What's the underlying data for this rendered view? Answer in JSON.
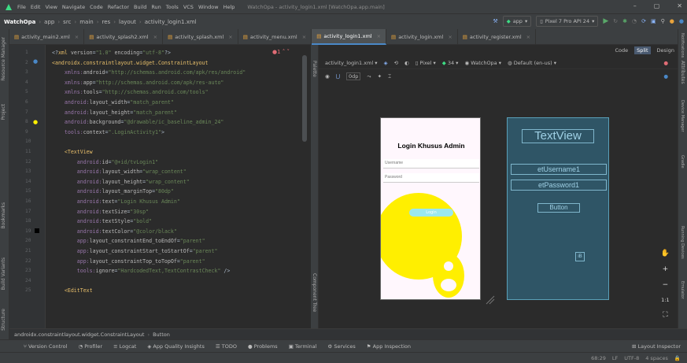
{
  "menu": {
    "items": [
      "File",
      "Edit",
      "View",
      "Navigate",
      "Code",
      "Refactor",
      "Build",
      "Run",
      "Tools",
      "VCS",
      "Window",
      "Help"
    ],
    "title": "WatchOpa - activity_login1.xml [WatchOpa.app.main]"
  },
  "toolbar": {
    "breadcrumb": [
      "WatchOpa",
      "app",
      "src",
      "main",
      "res",
      "layout",
      "activity_login1.xml"
    ],
    "run_config": "app",
    "device": "Pixel 7 Pro API 24"
  },
  "tabs": [
    {
      "label": "activity_main2.xml",
      "active": false
    },
    {
      "label": "activity_splash2.xml",
      "active": false
    },
    {
      "label": "activity_splash.xml",
      "active": false
    },
    {
      "label": "activity_menu.xml",
      "active": false
    },
    {
      "label": "activity_login1.xml",
      "active": true
    },
    {
      "label": "activity_login.xml",
      "active": false
    },
    {
      "label": "activity_register.xml",
      "active": false
    }
  ],
  "left_strip": [
    "Resource Manager",
    "Project",
    "Bookmarks",
    "Build Variants",
    "Structure"
  ],
  "right_strip": [
    "Notifications",
    "Device Manager",
    "Gradle",
    "Running Devices",
    "Emulator"
  ],
  "editor": {
    "warning_count": "1",
    "lines": [
      {
        "n": "1",
        "parts": [
          [
            "pun",
            "<?"
          ],
          [
            "tag",
            "xml "
          ],
          [
            "attr",
            "version"
          ],
          [
            "pun",
            "="
          ],
          [
            "val",
            "\"1.0\" "
          ],
          [
            "attr",
            "encoding"
          ],
          [
            "pun",
            "="
          ],
          [
            "val",
            "\"utf-8\""
          ],
          [
            "pun",
            "?>"
          ]
        ]
      },
      {
        "n": "2",
        "parts": [
          [
            "tag",
            "<androidx.constraintlayout.widget.ConstraintLayout"
          ]
        ]
      },
      {
        "n": "3",
        "parts": [
          [
            "ind",
            "    "
          ],
          [
            "ns",
            "xmlns:"
          ],
          [
            "attr",
            "android"
          ],
          [
            "pun",
            "="
          ],
          [
            "val",
            "\"http://schemas.android.com/apk/res/android\""
          ]
        ]
      },
      {
        "n": "4",
        "parts": [
          [
            "ind",
            "    "
          ],
          [
            "ns",
            "xmlns:"
          ],
          [
            "attr",
            "app"
          ],
          [
            "pun",
            "="
          ],
          [
            "val",
            "\"http://schemas.android.com/apk/res-auto\""
          ]
        ]
      },
      {
        "n": "5",
        "parts": [
          [
            "ind",
            "    "
          ],
          [
            "ns",
            "xmlns:"
          ],
          [
            "attr",
            "tools"
          ],
          [
            "pun",
            "="
          ],
          [
            "val",
            "\"http://schemas.android.com/tools\""
          ]
        ]
      },
      {
        "n": "6",
        "parts": [
          [
            "ind",
            "    "
          ],
          [
            "ns",
            "android:"
          ],
          [
            "attr",
            "layout_width"
          ],
          [
            "pun",
            "="
          ],
          [
            "val",
            "\"match_parent\""
          ]
        ]
      },
      {
        "n": "7",
        "parts": [
          [
            "ind",
            "    "
          ],
          [
            "ns",
            "android:"
          ],
          [
            "attr",
            "layout_height"
          ],
          [
            "pun",
            "="
          ],
          [
            "val",
            "\"match_parent\""
          ]
        ]
      },
      {
        "n": "8",
        "parts": [
          [
            "ind",
            "    "
          ],
          [
            "ns",
            "android:"
          ],
          [
            "attr",
            "background"
          ],
          [
            "pun",
            "="
          ],
          [
            "val",
            "\"@drawable/ic_baseline_admin_24\""
          ]
        ]
      },
      {
        "n": "9",
        "parts": [
          [
            "ind",
            "    "
          ],
          [
            "ns",
            "tools:"
          ],
          [
            "attr",
            "context"
          ],
          [
            "pun",
            "="
          ],
          [
            "val",
            "\".LoginActivity1\""
          ],
          [
            "pun",
            ">"
          ]
        ]
      },
      {
        "n": "10",
        "parts": []
      },
      {
        "n": "11",
        "parts": [
          [
            "ind",
            "    "
          ],
          [
            "tag",
            "<TextView"
          ]
        ]
      },
      {
        "n": "12",
        "parts": [
          [
            "ind",
            "        "
          ],
          [
            "ns",
            "android:"
          ],
          [
            "attr",
            "id"
          ],
          [
            "pun",
            "="
          ],
          [
            "val",
            "\"@+id/tvLogin1\""
          ]
        ]
      },
      {
        "n": "13",
        "parts": [
          [
            "ind",
            "        "
          ],
          [
            "ns",
            "android:"
          ],
          [
            "attr",
            "layout_width"
          ],
          [
            "pun",
            "="
          ],
          [
            "val",
            "\"wrap_content\""
          ]
        ]
      },
      {
        "n": "14",
        "parts": [
          [
            "ind",
            "        "
          ],
          [
            "ns",
            "android:"
          ],
          [
            "attr",
            "layout_height"
          ],
          [
            "pun",
            "="
          ],
          [
            "val",
            "\"wrap_content\""
          ]
        ]
      },
      {
        "n": "15",
        "parts": [
          [
            "ind",
            "        "
          ],
          [
            "ns",
            "android:"
          ],
          [
            "attr",
            "layout_marginTop"
          ],
          [
            "pun",
            "="
          ],
          [
            "val",
            "\"80dp\""
          ]
        ]
      },
      {
        "n": "16",
        "parts": [
          [
            "ind",
            "        "
          ],
          [
            "ns",
            "android:"
          ],
          [
            "attr",
            "text"
          ],
          [
            "pun",
            "="
          ],
          [
            "val",
            "\"Login Khusus Admin\""
          ]
        ]
      },
      {
        "n": "17",
        "parts": [
          [
            "ind",
            "        "
          ],
          [
            "ns",
            "android:"
          ],
          [
            "attr",
            "textSize"
          ],
          [
            "pun",
            "="
          ],
          [
            "val",
            "\"30sp\""
          ]
        ]
      },
      {
        "n": "18",
        "parts": [
          [
            "ind",
            "        "
          ],
          [
            "ns",
            "android:"
          ],
          [
            "attr",
            "textStyle"
          ],
          [
            "pun",
            "="
          ],
          [
            "val",
            "\"bold\""
          ]
        ]
      },
      {
        "n": "19",
        "parts": [
          [
            "ind",
            "        "
          ],
          [
            "ns",
            "android:"
          ],
          [
            "attr",
            "textColor"
          ],
          [
            "pun",
            "="
          ],
          [
            "val",
            "\"@color/black\""
          ]
        ]
      },
      {
        "n": "20",
        "parts": [
          [
            "ind",
            "        "
          ],
          [
            "ns",
            "app:"
          ],
          [
            "attr",
            "layout_constraintEnd_toEndOf"
          ],
          [
            "pun",
            "="
          ],
          [
            "val",
            "\"parent\""
          ]
        ]
      },
      {
        "n": "21",
        "parts": [
          [
            "ind",
            "        "
          ],
          [
            "ns",
            "app:"
          ],
          [
            "attr",
            "layout_constraintStart_toStartOf"
          ],
          [
            "pun",
            "="
          ],
          [
            "val",
            "\"parent\""
          ]
        ]
      },
      {
        "n": "22",
        "parts": [
          [
            "ind",
            "        "
          ],
          [
            "ns",
            "app:"
          ],
          [
            "attr",
            "layout_constraintTop_toTopOf"
          ],
          [
            "pun",
            "="
          ],
          [
            "val",
            "\"parent\""
          ]
        ]
      },
      {
        "n": "23",
        "parts": [
          [
            "ind",
            "        "
          ],
          [
            "ns",
            "tools:"
          ],
          [
            "attr",
            "ignore"
          ],
          [
            "pun",
            "="
          ],
          [
            "val",
            "\"HardcodedText,TextContrastCheck\" "
          ],
          [
            "pun",
            "/>"
          ]
        ]
      },
      {
        "n": "24",
        "parts": []
      },
      {
        "n": "25",
        "parts": [
          [
            "ind",
            "    "
          ],
          [
            "tag",
            "<EditText"
          ]
        ]
      }
    ]
  },
  "design": {
    "modes": [
      "Code",
      "Split",
      "Design"
    ],
    "active_mode": "Split",
    "file_dropdown": "activity_login1.xml",
    "device": "Pixel",
    "api": "34",
    "theme": "WatchOpa",
    "locale": "Default (en-us)",
    "margin": "0dp",
    "palette_label": "Palette",
    "component_tree_label": "Component Tree",
    "attributes_label": "Attributes",
    "preview": {
      "title": "Login Khusus Admin",
      "username_hint": "Username",
      "password_hint": "Password",
      "button": "Login"
    },
    "blueprint": {
      "textview": "TextView",
      "username": "etUsername1",
      "password": "etPassword1",
      "button": "Button",
      "image_badge": "iB"
    },
    "zoom_labels": [
      "+",
      "−",
      "1:1"
    ]
  },
  "breadcrumb_bar": [
    "androidx.constraintlayout.widget.ConstraintLayout",
    "Button"
  ],
  "bottom_tools": [
    "Version Control",
    "Profiler",
    "Logcat",
    "App Quality Insights",
    "TODO",
    "Problems",
    "Terminal",
    "Services",
    "App Inspection"
  ],
  "layout_inspector": "Layout Inspector",
  "status": {
    "position": "68:29",
    "line_sep": "LF",
    "encoding": "UTF-8",
    "indent": "4 spaces"
  }
}
